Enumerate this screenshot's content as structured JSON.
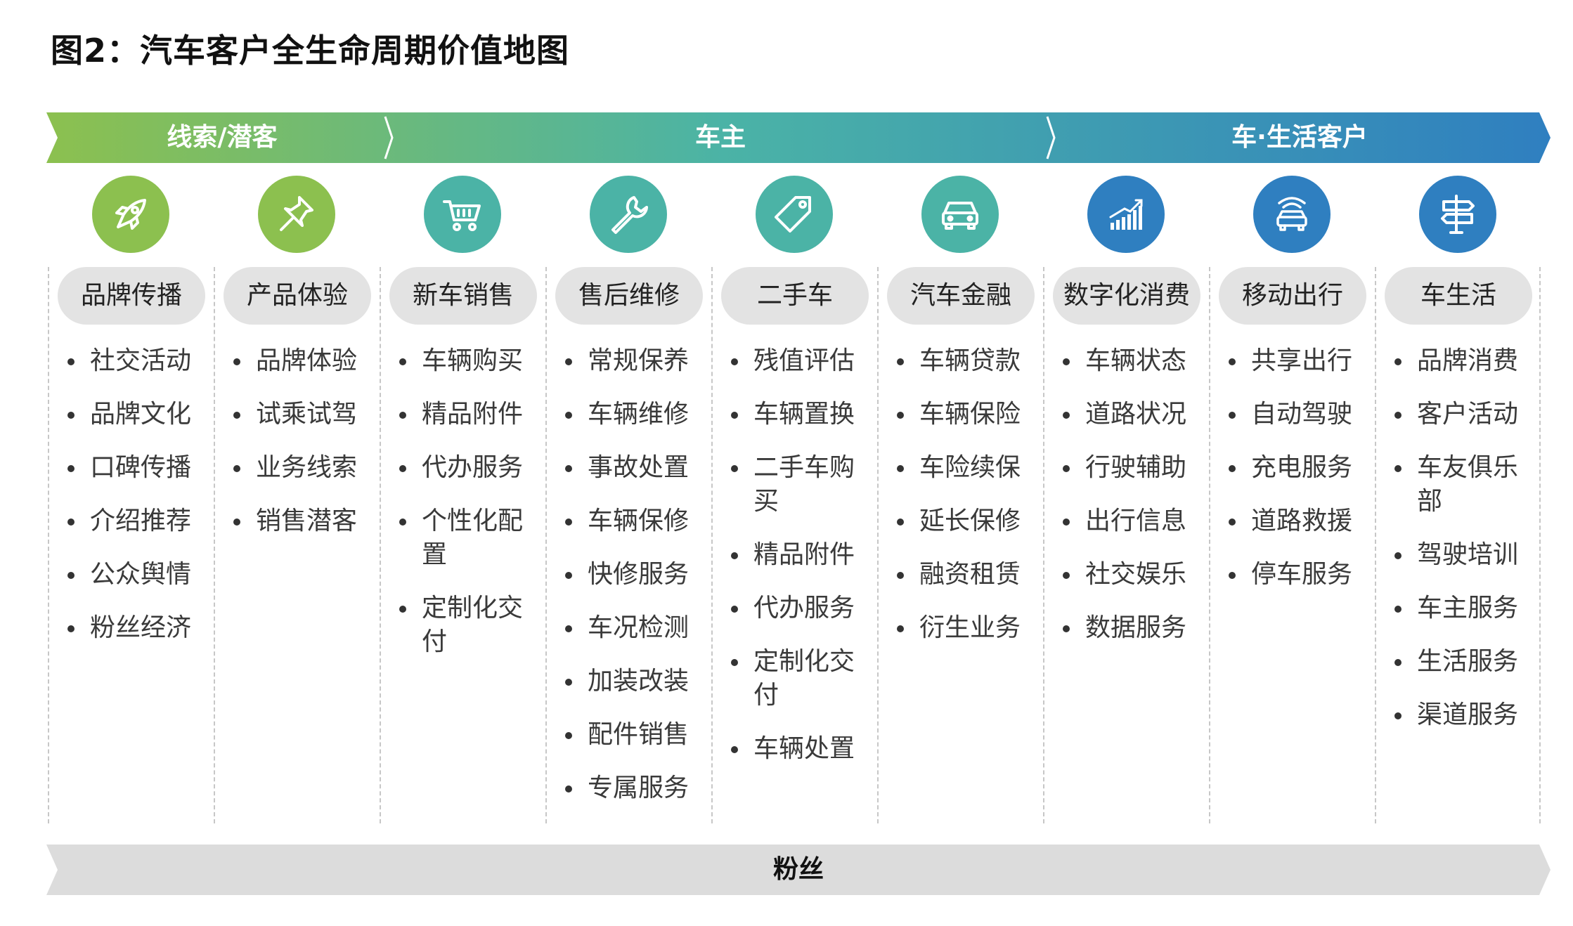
{
  "title": "图2：汽车客户全生命周期价值地图",
  "phases": [
    {
      "label": "线索/潜客"
    },
    {
      "label": "车主"
    },
    {
      "label": "车·生活客户"
    }
  ],
  "columns": [
    {
      "label": "品牌传播",
      "icon": "rocket-icon",
      "color": "#8cc04f",
      "items": [
        "社交活动",
        "品牌文化",
        "口碑传播",
        "介绍推荐",
        "公众舆情",
        "粉丝经济"
      ]
    },
    {
      "label": "产品体验",
      "icon": "pushpin-icon",
      "color": "#8cc04f",
      "items": [
        "品牌体验",
        "试乘试驾",
        "业务线索",
        "销售潜客"
      ]
    },
    {
      "label": "新车销售",
      "icon": "shopping-cart-icon",
      "color": "#4bb3a6",
      "items": [
        "车辆购买",
        "精品附件",
        "代办服务",
        "个性化配置",
        "定制化交付"
      ]
    },
    {
      "label": "售后维修",
      "icon": "wrench-icon",
      "color": "#4bb3a6",
      "items": [
        "常规保养",
        "车辆维修",
        "事故处置",
        "车辆保修",
        "快修服务",
        "车况检测",
        "加装改装",
        "配件销售",
        "专属服务"
      ]
    },
    {
      "label": "二手车",
      "icon": "price-tag-icon",
      "color": "#4bb3a6",
      "items": [
        "残值评估",
        "车辆置换",
        "二手车购买",
        "精品附件",
        "代办服务",
        "定制化交付",
        "车辆处置"
      ]
    },
    {
      "label": "汽车金融",
      "icon": "car-icon",
      "color": "#4bb3a6",
      "items": [
        "车辆贷款",
        "车辆保险",
        "车险续保",
        "延长保修",
        "融资租赁",
        "衍生业务"
      ]
    },
    {
      "label": "数字化消费",
      "icon": "growth-chart-icon",
      "color": "#2f7fc0",
      "items": [
        "车辆状态",
        "道路状况",
        "行驶辅助",
        "出行信息",
        "社交娱乐",
        "数据服务"
      ]
    },
    {
      "label": "移动出行",
      "icon": "connected-car-icon",
      "color": "#2f7fc0",
      "items": [
        "共享出行",
        "自动驾驶",
        "充电服务",
        "道路救援",
        "停车服务"
      ]
    },
    {
      "label": "车生活",
      "icon": "signpost-icon",
      "color": "#2f7fc0",
      "items": [
        "品牌消费",
        "客户活动",
        "车友俱乐部",
        "驾驶培训",
        "车主服务",
        "生活服务",
        "渠道服务"
      ]
    }
  ],
  "bottom_band": {
    "label": "粉丝"
  }
}
